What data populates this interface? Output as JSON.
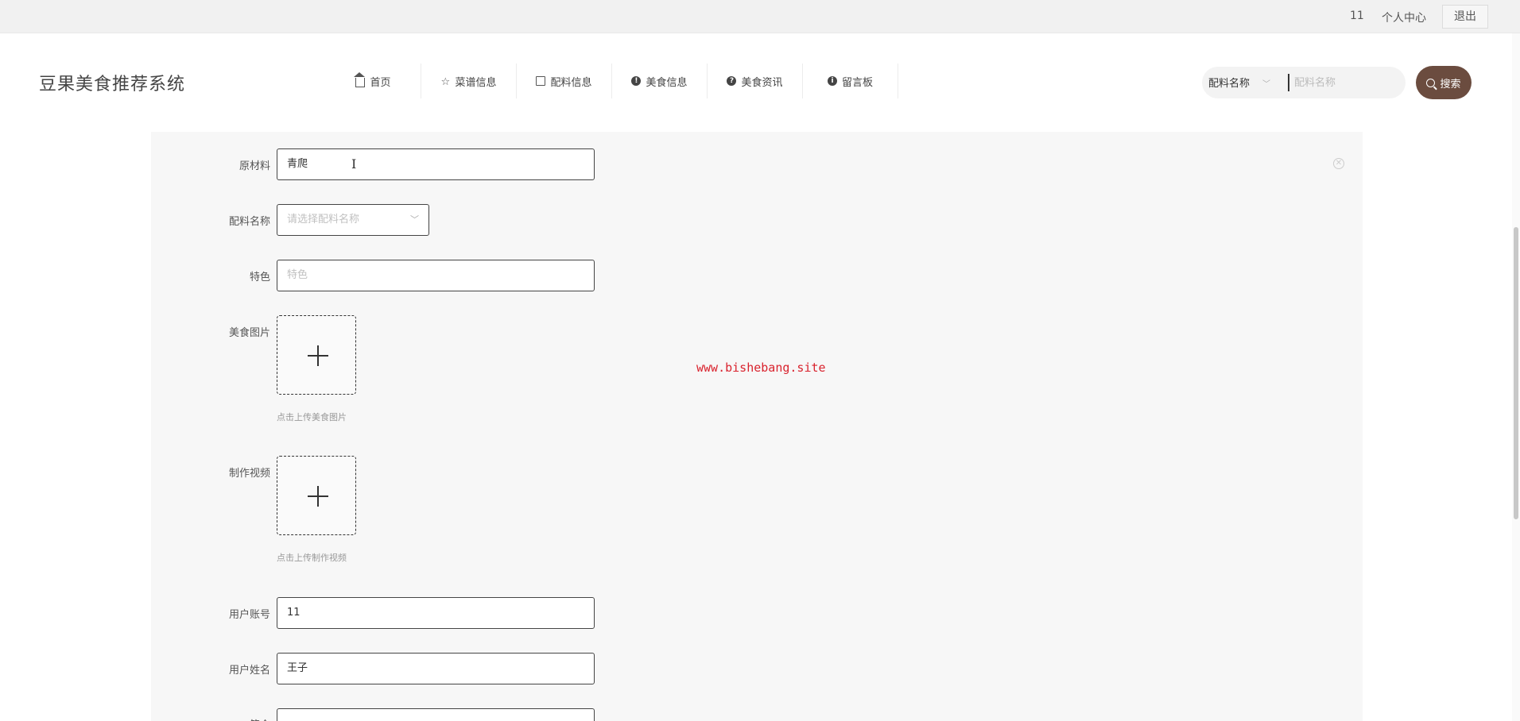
{
  "topbar": {
    "username": "11",
    "profile_label": "个人中心",
    "logout_label": "退出"
  },
  "header": {
    "brand": "豆果美食推荐系统",
    "nav": [
      {
        "label": "首页",
        "icon": "home-icon"
      },
      {
        "label": "菜谱信息",
        "icon": "star-icon"
      },
      {
        "label": "配料信息",
        "icon": "bag-icon"
      },
      {
        "label": "美食信息",
        "icon": "info-icon"
      },
      {
        "label": "美食资讯",
        "icon": "question-icon"
      },
      {
        "label": "留言板",
        "icon": "info-icon"
      }
    ],
    "search": {
      "select_value": "配料名称",
      "placeholder": "配料名称",
      "button_label": "搜索"
    }
  },
  "form": {
    "raw_material": {
      "label": "原材料",
      "value": "青爬"
    },
    "ingredient_name": {
      "label": "配料名称",
      "placeholder": "请选择配料名称"
    },
    "feature": {
      "label": "特色",
      "placeholder": "特色"
    },
    "food_image": {
      "label": "美食图片",
      "hint": "点击上传美食图片"
    },
    "video": {
      "label": "制作视频",
      "hint": "点击上传制作视频"
    },
    "account": {
      "label": "用户账号",
      "value": "11"
    },
    "user_name": {
      "label": "用户姓名",
      "value": "王子"
    },
    "partial_label": "简介"
  },
  "watermark": "www.bishebang.site"
}
